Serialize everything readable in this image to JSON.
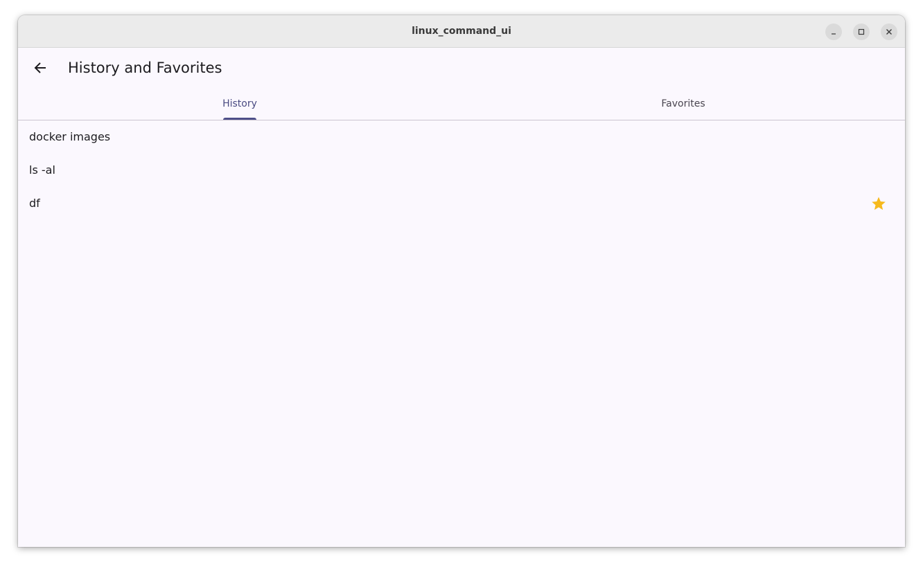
{
  "window": {
    "title": "linux_command_ui"
  },
  "appbar": {
    "title": "History and Favorites",
    "back_icon": "arrow-back-icon"
  },
  "tabs": [
    {
      "label": "History",
      "selected": true
    },
    {
      "label": "Favorites",
      "selected": false
    }
  ],
  "history": {
    "items": [
      {
        "command": "docker images",
        "favorite": false
      },
      {
        "command": "ls -al",
        "favorite": false
      },
      {
        "command": "df",
        "favorite": true
      }
    ]
  },
  "colors": {
    "background": "#fbf8fe",
    "accent": "#4e4f89",
    "star": "#f6b91c"
  }
}
